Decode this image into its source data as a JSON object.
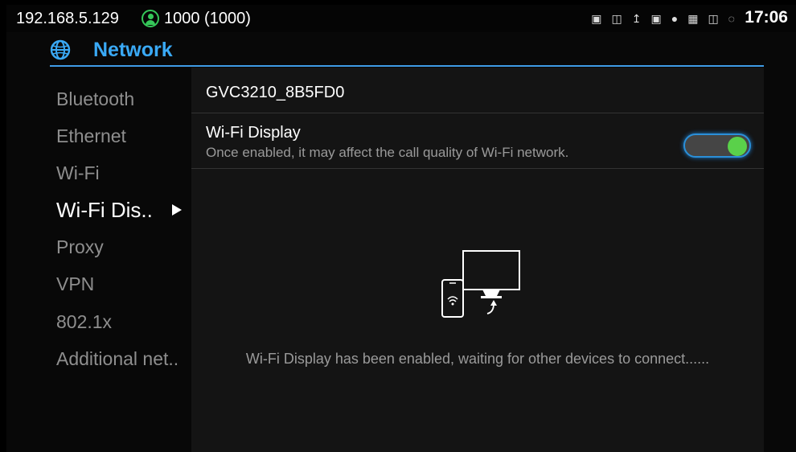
{
  "status_bar": {
    "ip": "192.168.5.129",
    "account": "1000 (1000)",
    "time": "17:06",
    "icons": [
      "image-icon",
      "network-sharing-icon",
      "upload-icon",
      "lock-icon",
      "location-icon",
      "sd-card-icon",
      "ethernet-icon",
      "wifi-icon"
    ]
  },
  "header": {
    "title": "Network",
    "icon": "globe-icon"
  },
  "sidebar": {
    "items": [
      {
        "label": "Bluetooth"
      },
      {
        "label": "Ethernet"
      },
      {
        "label": "Wi-Fi"
      },
      {
        "label": "Wi-Fi Dis.."
      },
      {
        "label": "Proxy"
      },
      {
        "label": "VPN"
      },
      {
        "label": "802.1x"
      },
      {
        "label": "Additional net.."
      }
    ],
    "active_index": 3
  },
  "content": {
    "device_name": "GVC3210_8B5FD0",
    "wifi_display": {
      "title": "Wi-Fi Display",
      "description": "Once enabled, it may affect the call quality of Wi-Fi network.",
      "enabled": true
    },
    "status_message": "Wi-Fi Display has been enabled, waiting for other devices to connect......"
  },
  "colors": {
    "accent": "#3aa9f5",
    "toggle_on": "#5ad14a",
    "presence": "#35c759"
  }
}
